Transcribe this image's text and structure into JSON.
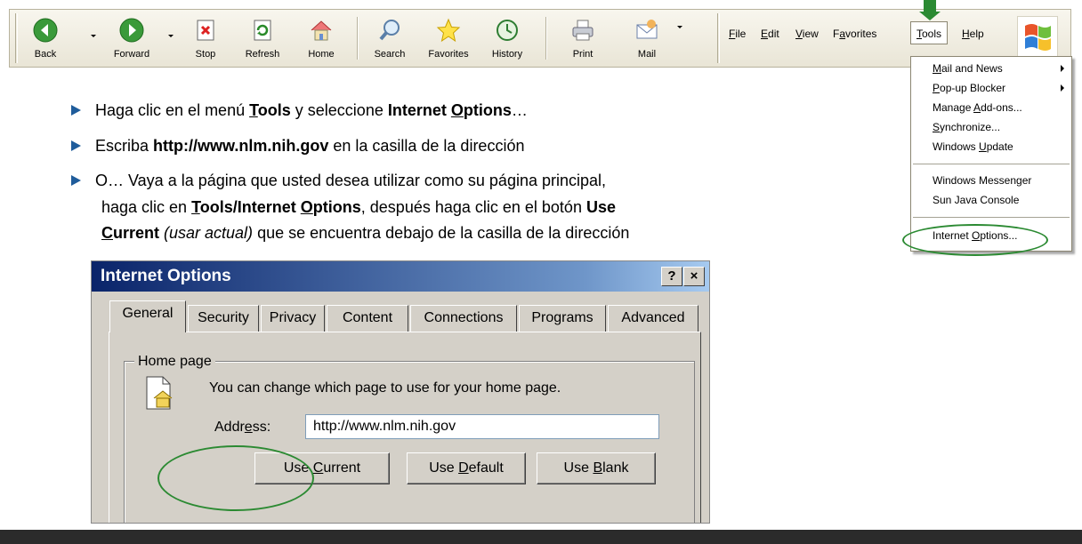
{
  "toolbar": {
    "buttons": [
      {
        "label": "Back"
      },
      {
        "label": "Forward"
      },
      {
        "label": "Stop"
      },
      {
        "label": "Refresh"
      },
      {
        "label": "Home"
      },
      {
        "label": "Search"
      },
      {
        "label": "Favorites"
      },
      {
        "label": "History"
      },
      {
        "label": "Print"
      },
      {
        "label": "Mail"
      }
    ],
    "menus": [
      {
        "pre": "",
        "u": "F",
        "post": "ile"
      },
      {
        "pre": "",
        "u": "E",
        "post": "dit"
      },
      {
        "pre": "",
        "u": "V",
        "post": "iew"
      },
      {
        "pre": "F",
        "u": "a",
        "post": "vorites"
      },
      {
        "pre": "",
        "u": "T",
        "post": "ools"
      },
      {
        "pre": "",
        "u": "H",
        "post": "elp"
      }
    ]
  },
  "tools_menu": {
    "items": [
      {
        "pre": "",
        "u": "M",
        "post": "ail and News"
      },
      {
        "pre": "",
        "u": "P",
        "post": "op-up Blocker"
      },
      {
        "pre": "Manage ",
        "u": "A",
        "post": "dd-ons..."
      },
      {
        "pre": "",
        "u": "S",
        "post": "ynchronize..."
      },
      {
        "pre": "Windows ",
        "u": "U",
        "post": "pdate"
      },
      {
        "pre": "Windows Messenger",
        "u": "",
        "post": ""
      },
      {
        "pre": "Sun Java Console",
        "u": "",
        "post": ""
      },
      {
        "pre": "Internet ",
        "u": "O",
        "post": "ptions..."
      }
    ]
  },
  "instructions": {
    "b1": {
      "t1": "Haga clic en el menú ",
      "b1": "Tools",
      "t2": " y seleccione ",
      "b2": "Internet Options",
      "t3": "…"
    },
    "b2": {
      "t1": "Escriba ",
      "b1": "http://www.nlm.nih.gov",
      "t2": " en la casilla de la dirección"
    },
    "b3": {
      "line1": "O… Vaya a la página que usted desea utilizar como su página principal,",
      "line2_t1": "haga clic en ",
      "line2_b": "Tools/Internet Options",
      "line2_t2": ", después haga clic en el botón ",
      "line2_b2": "Use",
      "line3_b": "Current",
      "line3_i": " (usar actual)",
      "line3_t": " que se encuentra debajo de la casilla de la dirección"
    }
  },
  "dialog": {
    "title": "Internet Options",
    "help": "?",
    "close": "×",
    "tabs": [
      "General",
      "Security",
      "Privacy",
      "Content",
      "Connections",
      "Programs",
      "Advanced"
    ],
    "group_label": "Home page",
    "desc": "You can change which page to use for your home page.",
    "address_label_pre": "Addr",
    "address_label_u": "e",
    "address_label_post": "ss:",
    "address_value": "http://www.nlm.nih.gov",
    "btn_current_pre": "Use ",
    "btn_current_u": "C",
    "btn_current_post": "urrent",
    "btn_default_pre": "Use ",
    "btn_default_u": "D",
    "btn_default_post": "efault",
    "btn_blank_pre": "Use ",
    "btn_blank_u": "B",
    "btn_blank_post": "lank"
  },
  "colors": {
    "highlight": "#2b8a32",
    "bullet": "#1f5c9b",
    "title_bar": "#0a246a"
  }
}
